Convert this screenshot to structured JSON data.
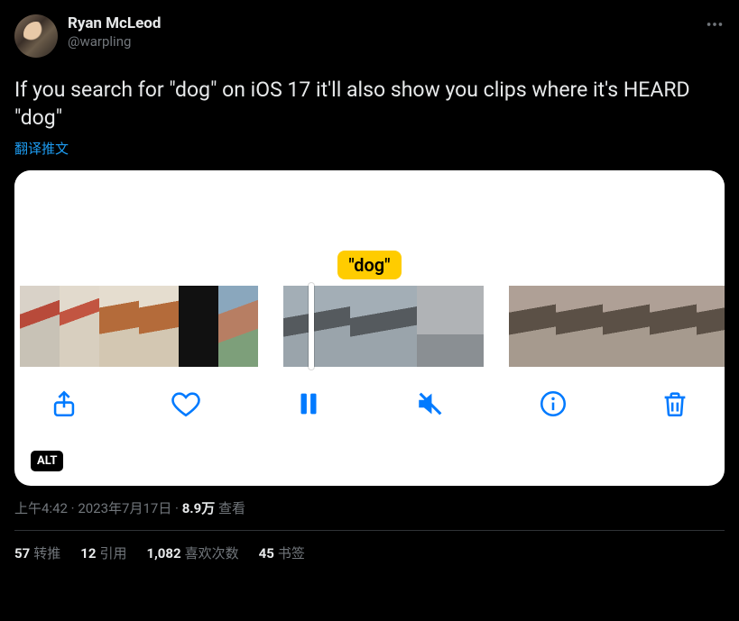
{
  "author": {
    "display_name": "Ryan McLeod",
    "handle": "@warpling"
  },
  "tweet_text": "If you search for \"dog\" on iOS 17 it'll also show you clips where it's HEARD \"dog\"",
  "translate_label": "翻译推文",
  "media": {
    "search_tag": "\"dog\"",
    "alt_label": "ALT",
    "toolbar": [
      "share",
      "like",
      "pause",
      "mute",
      "info",
      "delete"
    ]
  },
  "meta": {
    "time": "上午4:42",
    "separator": " · ",
    "date": "2023年7月17日",
    "views_count": "8.9万",
    "views_suffix": " 查看"
  },
  "stats": {
    "retweets_count": "57",
    "retweets_label": "转推",
    "quotes_count": "12",
    "quotes_label": "引用",
    "likes_count": "1,082",
    "likes_label": "喜欢次数",
    "bookmarks_count": "45",
    "bookmarks_label": "书签"
  }
}
